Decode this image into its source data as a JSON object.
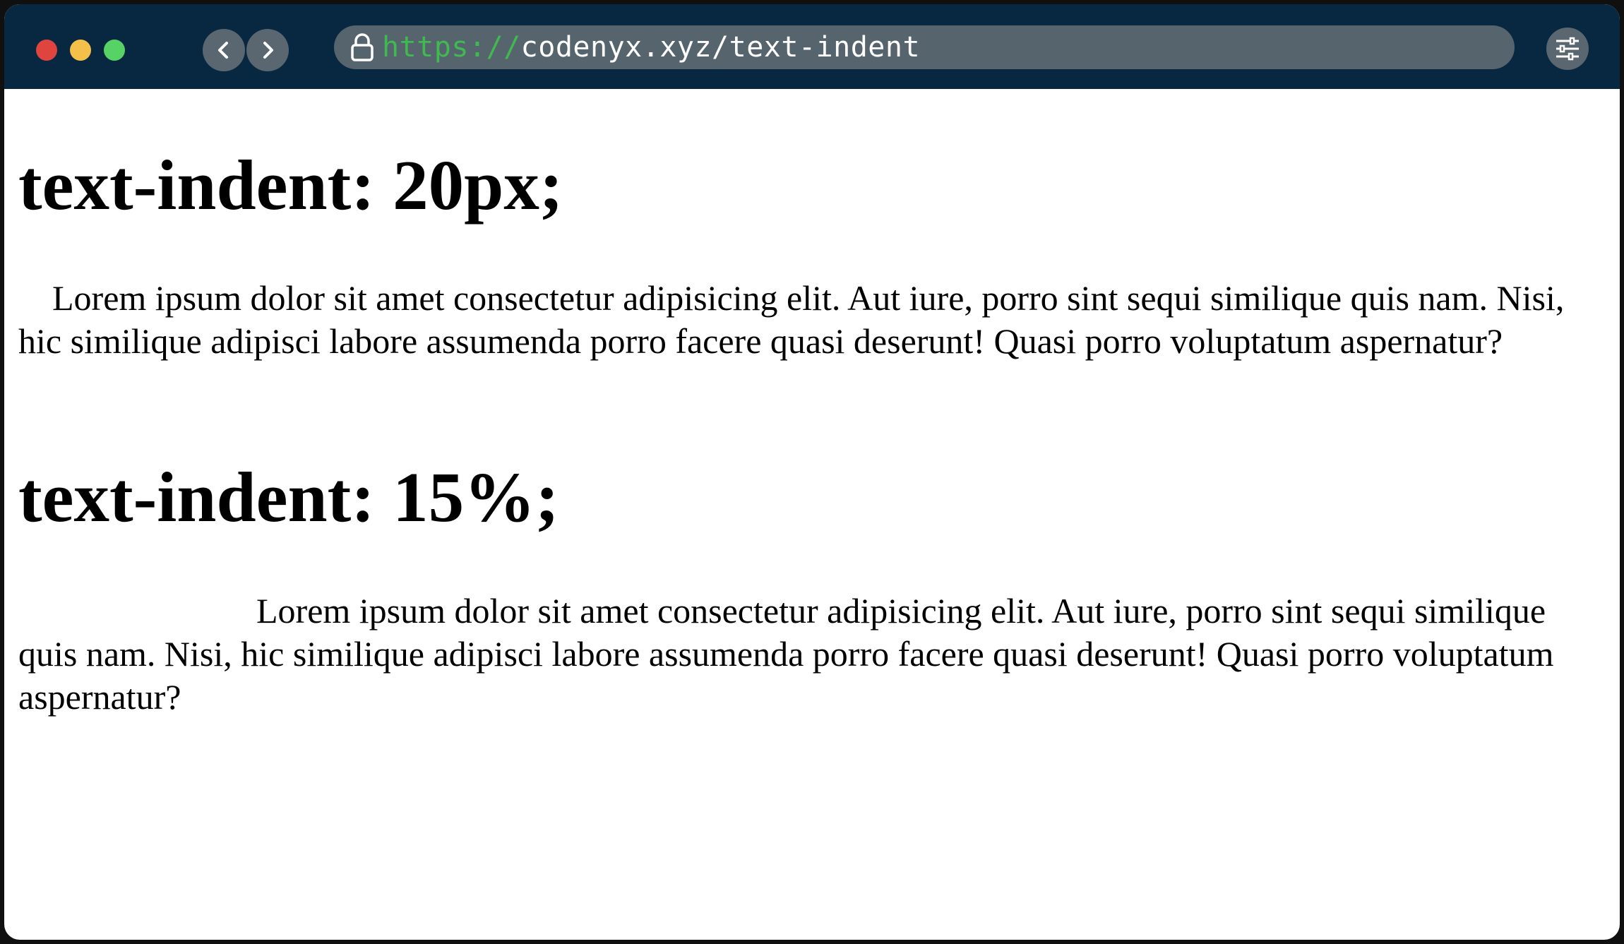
{
  "browser": {
    "url_scheme": "https://",
    "url_path": "codenyx.xyz/text-indent",
    "icons": {
      "back": "chevron-left-icon",
      "forward": "chevron-right-icon",
      "lock": "lock-icon",
      "settings": "sliders-icon"
    },
    "colors": {
      "titlebar": "#072840",
      "urlbar": "#56646e",
      "scheme": "#3fb950",
      "close": "#e0443e",
      "minimize": "#f5c04a",
      "maximize": "#56d364"
    }
  },
  "page": {
    "sections": [
      {
        "heading": "text-indent: 20px;",
        "paragraph": "Lorem ipsum dolor sit amet consectetur adipisicing elit. Aut iure, porro sint sequi similique quis nam. Nisi, hic similique adipisci labore assumenda porro facere quasi deserunt! Quasi porro voluptatum aspernatur?"
      },
      {
        "heading": "text-indent: 15%;",
        "paragraph": "Lorem ipsum dolor sit amet consectetur adipisicing elit. Aut iure, porro sint sequi similique quis nam. Nisi, hic similique adipisci labore assumenda porro facere quasi deserunt! Quasi porro voluptatum aspernatur?"
      }
    ]
  }
}
